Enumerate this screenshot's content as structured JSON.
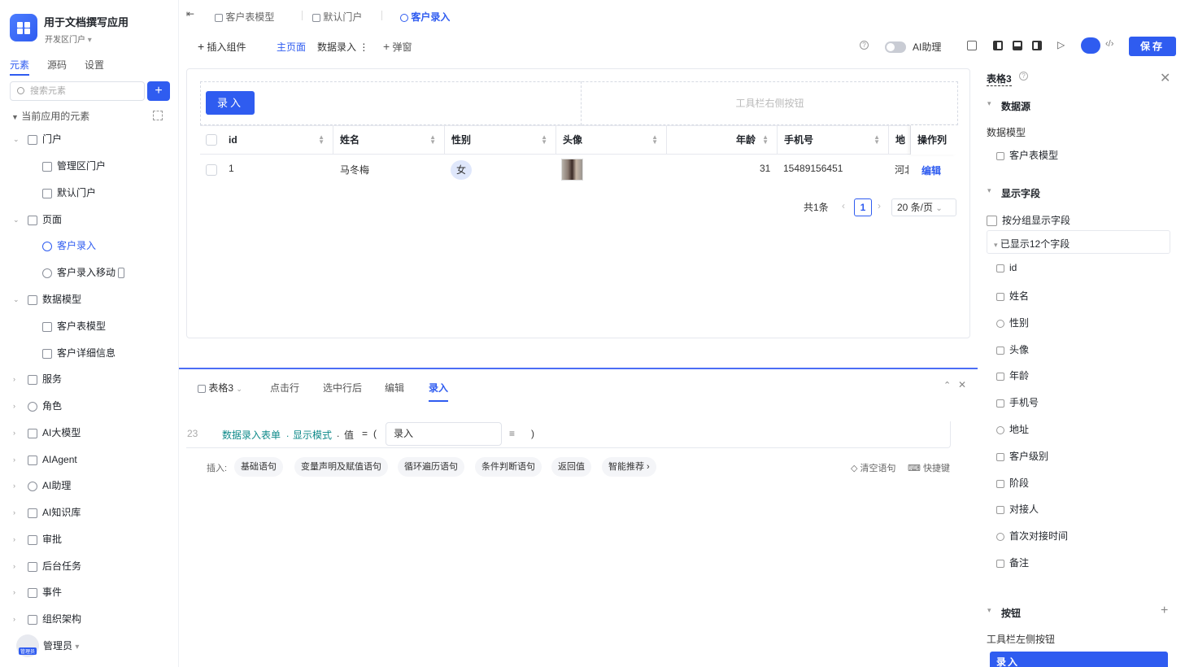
{
  "app": {
    "title": "用于文档撰写应用",
    "subtitle": "开发区门户"
  },
  "sidebar": {
    "tabs": [
      "元素",
      "源码",
      "设置"
    ],
    "search_placeholder": "搜索元素",
    "add_label": "+",
    "section_title": "当前应用的元素",
    "items": [
      {
        "label": "门户",
        "icon": "home-icon"
      },
      {
        "label": "管理区门户",
        "icon": "portal-icon"
      },
      {
        "label": "默认门户",
        "icon": "portal-icon"
      },
      {
        "label": "页面",
        "icon": "page-icon"
      },
      {
        "label": "客户录入",
        "icon": "page-item-icon",
        "active": true
      },
      {
        "label": "客户录入移动",
        "icon": "page-item-icon"
      },
      {
        "label": "数据模型",
        "icon": "table-icon"
      },
      {
        "label": "客户表模型",
        "icon": "table-icon"
      },
      {
        "label": "客户详细信息",
        "icon": "table-icon"
      },
      {
        "label": "服务",
        "icon": "service-icon"
      },
      {
        "label": "角色",
        "icon": "role-icon"
      },
      {
        "label": "AI大模型",
        "icon": "ai-model-icon"
      },
      {
        "label": "AIAgent",
        "icon": "agent-icon"
      },
      {
        "label": "AI助理",
        "icon": "ai-assistant-icon"
      },
      {
        "label": "AI知识库",
        "icon": "knowledge-icon"
      },
      {
        "label": "审批",
        "icon": "approval-icon"
      },
      {
        "label": "后台任务",
        "icon": "task-icon"
      },
      {
        "label": "事件",
        "icon": "event-icon"
      },
      {
        "label": "组织架构",
        "icon": "org-icon"
      }
    ],
    "user": {
      "name": "管理员",
      "badge": "管理员"
    }
  },
  "top_tabs": [
    {
      "label": "客户表模型"
    },
    {
      "label": "默认门户"
    },
    {
      "label": "客户录入",
      "active": true
    }
  ],
  "toolbar": {
    "insert": "插入组件",
    "main_page": "主页面",
    "data_entry": "数据录入",
    "popup": "弹窗",
    "ai_label": "AI助理",
    "save": "保存"
  },
  "canvas": {
    "entry_button": "录入",
    "toolbar_right_placeholder": "工具栏右侧按钮",
    "columns": [
      "id",
      "姓名",
      "性别",
      "头像",
      "年龄",
      "手机号",
      "地址",
      "操作列"
    ],
    "rows": [
      {
        "id": "1",
        "name": "马冬梅",
        "gender": "女",
        "age": "31",
        "phone": "15489156451",
        "address": "河北",
        "action": "编辑"
      }
    ],
    "pagination": {
      "total": "共1条",
      "page": "1",
      "page_size": "20 条/页"
    }
  },
  "bottom_panel": {
    "tabs": [
      {
        "label": "表格3"
      },
      {
        "label": "点击行"
      },
      {
        "label": "选中行后"
      },
      {
        "label": "编辑"
      },
      {
        "label": "录入",
        "active": true
      }
    ],
    "code": {
      "line": "23",
      "target": "数据录入表单",
      "dot1": ".",
      "prop1": "显示模式",
      "dot2": ".",
      "prop2": "值",
      "eq": "=",
      "lparen": "(",
      "value": "录入",
      "rparen": ")"
    },
    "insert_label": "插入:",
    "chips": [
      "基础语句",
      "变量声明及赋值语句",
      "循环遍历语句",
      "条件判断语句",
      "返回值",
      "智能推荐 ›"
    ],
    "clear": "清空语句",
    "shortcuts": "快捷键"
  },
  "right_panel": {
    "title": "表格3",
    "section_datasource": "数据源",
    "model_label": "数据模型",
    "model_value": "客户表模型",
    "section_fields": "显示字段",
    "group_display": "按分组显示字段",
    "shown_fields": "已显示12个字段",
    "fields": [
      "id",
      "姓名",
      "性别",
      "头像",
      "年龄",
      "手机号",
      "地址",
      "客户级别",
      "阶段",
      "对接人",
      "首次对接时间",
      "备注"
    ],
    "section_buttons": "按钮",
    "toolbar_left_label": "工具栏左侧按钮",
    "entry_button": "录入"
  }
}
